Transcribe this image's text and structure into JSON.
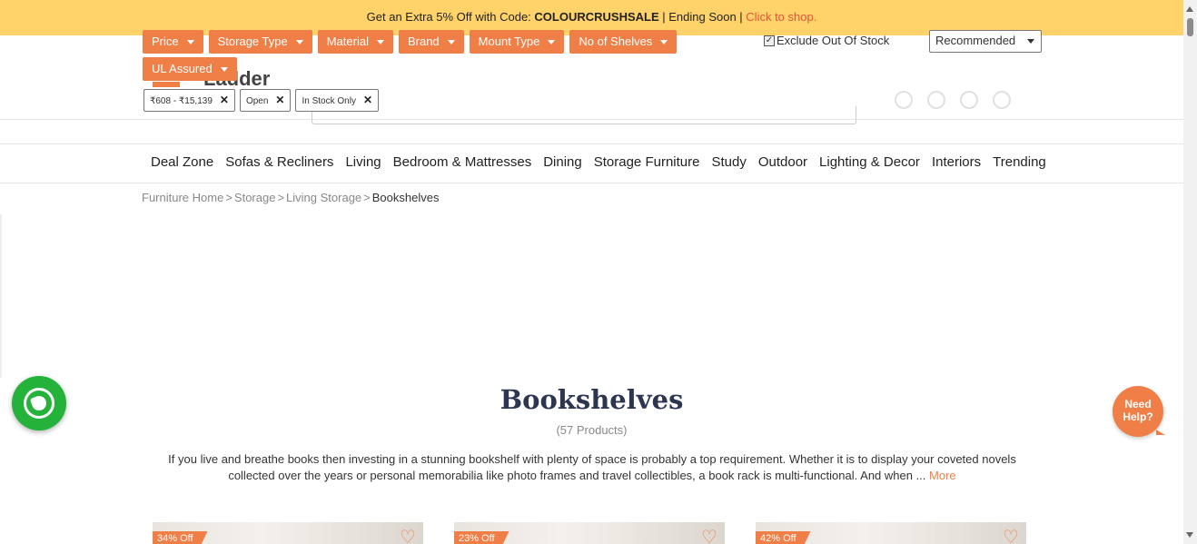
{
  "promo": {
    "prefix": "Get an Extra 5% Off with Code: ",
    "code": "COLOURCRUSHSALE",
    "middle": " | Ending Soon | ",
    "link": "Click to shop."
  },
  "header": {
    "logo_text": "Ladder"
  },
  "filters": {
    "chips": [
      "Price",
      "Storage Type",
      "Material",
      "Brand",
      "Mount Type",
      "No of Shelves",
      "UL Assured"
    ],
    "applied": [
      "₹608 - ₹15,139",
      "Open",
      "In Stock Only"
    ],
    "exclude_label": "Exclude Out Of Stock",
    "exclude_checked": true,
    "sort_value": "Recommended"
  },
  "nav": {
    "items": [
      "Deal Zone",
      "Sofas & Recliners",
      "Living",
      "Bedroom & Mattresses",
      "Dining",
      "Storage Furniture",
      "Study",
      "Outdoor",
      "Lighting & Decor",
      "Interiors",
      "Trending"
    ]
  },
  "breadcrumb": {
    "items": [
      "Furniture Home",
      "Storage",
      "Living Storage"
    ],
    "current": "Bookshelves",
    "separator": ">"
  },
  "page": {
    "title": "Bookshelves",
    "count": "(57 Products)",
    "description": "If you live and breathe books then investing in a stunning bookshelf with plenty of space is probably a top requirement. Whether it is to display your coveted novels collected over the years or personal memorabilia like photo frames and travel collectibles, a book rack is multi-functional. And when ...",
    "more": "More"
  },
  "help": {
    "line1": "Need",
    "line2": "Help?"
  },
  "products": [
    {
      "badge": "34% Off"
    },
    {
      "badge": "23% Off"
    },
    {
      "badge": "42% Off"
    }
  ],
  "colors": {
    "accent": "#f07f47",
    "promo_bg": "#ffd36a",
    "whatsapp": "#25b23a",
    "title": "#2c3650"
  },
  "icons": [
    "whatsapp-icon",
    "heart-icon",
    "close-icon",
    "chevron-down-icon"
  ]
}
